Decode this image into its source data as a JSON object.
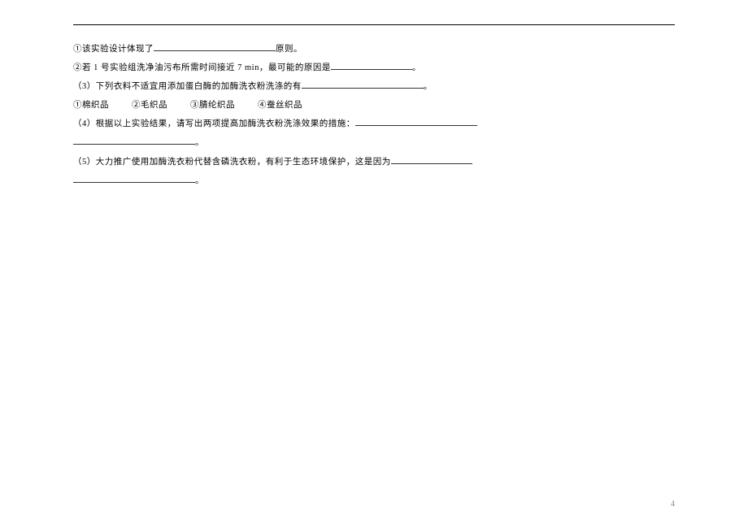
{
  "lines": {
    "l1_prefix": "①该实验设计体现了",
    "l1_suffix": "原则。",
    "l2_prefix": "②若 1 号实验组洗净油污布所需时间接近 7 min，最可能的原因是",
    "l2_suffix": "。",
    "l3_prefix": "（3）下列衣料不适宜用添加蛋白酶的加酶洗衣粉洗涤的有",
    "l3_suffix": "。",
    "l4_o1": "①棉织品",
    "l4_o2": "②毛织品",
    "l4_o3": "③腈纶织品",
    "l4_o4": "④蚕丝织品",
    "l5_prefix": "（4）根据以上实验结果，请写出两项提高加酶洗衣粉洗涤效果的措施：",
    "l6_suffix": "。",
    "l7_prefix": "（5）大力推广使用加酶洗衣粉代替含磷洗衣粉，有利于生态环境保护，这是因为",
    "l8_suffix": "。"
  },
  "pageNumber": "4"
}
